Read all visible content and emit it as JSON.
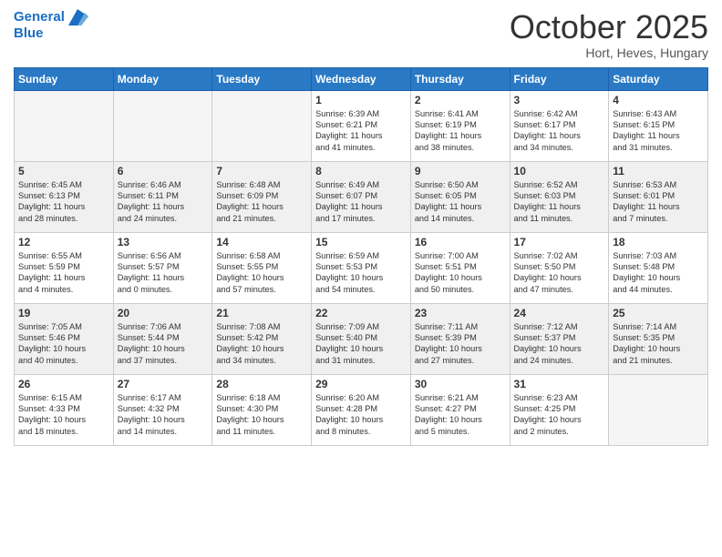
{
  "header": {
    "logo_line1": "General",
    "logo_line2": "Blue",
    "title": "October 2025",
    "subtitle": "Hort, Heves, Hungary"
  },
  "days_of_week": [
    "Sunday",
    "Monday",
    "Tuesday",
    "Wednesday",
    "Thursday",
    "Friday",
    "Saturday"
  ],
  "weeks": [
    [
      {
        "day": "",
        "info": ""
      },
      {
        "day": "",
        "info": ""
      },
      {
        "day": "",
        "info": ""
      },
      {
        "day": "1",
        "info": "Sunrise: 6:39 AM\nSunset: 6:21 PM\nDaylight: 11 hours\nand 41 minutes."
      },
      {
        "day": "2",
        "info": "Sunrise: 6:41 AM\nSunset: 6:19 PM\nDaylight: 11 hours\nand 38 minutes."
      },
      {
        "day": "3",
        "info": "Sunrise: 6:42 AM\nSunset: 6:17 PM\nDaylight: 11 hours\nand 34 minutes."
      },
      {
        "day": "4",
        "info": "Sunrise: 6:43 AM\nSunset: 6:15 PM\nDaylight: 11 hours\nand 31 minutes."
      }
    ],
    [
      {
        "day": "5",
        "info": "Sunrise: 6:45 AM\nSunset: 6:13 PM\nDaylight: 11 hours\nand 28 minutes."
      },
      {
        "day": "6",
        "info": "Sunrise: 6:46 AM\nSunset: 6:11 PM\nDaylight: 11 hours\nand 24 minutes."
      },
      {
        "day": "7",
        "info": "Sunrise: 6:48 AM\nSunset: 6:09 PM\nDaylight: 11 hours\nand 21 minutes."
      },
      {
        "day": "8",
        "info": "Sunrise: 6:49 AM\nSunset: 6:07 PM\nDaylight: 11 hours\nand 17 minutes."
      },
      {
        "day": "9",
        "info": "Sunrise: 6:50 AM\nSunset: 6:05 PM\nDaylight: 11 hours\nand 14 minutes."
      },
      {
        "day": "10",
        "info": "Sunrise: 6:52 AM\nSunset: 6:03 PM\nDaylight: 11 hours\nand 11 minutes."
      },
      {
        "day": "11",
        "info": "Sunrise: 6:53 AM\nSunset: 6:01 PM\nDaylight: 11 hours\nand 7 minutes."
      }
    ],
    [
      {
        "day": "12",
        "info": "Sunrise: 6:55 AM\nSunset: 5:59 PM\nDaylight: 11 hours\nand 4 minutes."
      },
      {
        "day": "13",
        "info": "Sunrise: 6:56 AM\nSunset: 5:57 PM\nDaylight: 11 hours\nand 0 minutes."
      },
      {
        "day": "14",
        "info": "Sunrise: 6:58 AM\nSunset: 5:55 PM\nDaylight: 10 hours\nand 57 minutes."
      },
      {
        "day": "15",
        "info": "Sunrise: 6:59 AM\nSunset: 5:53 PM\nDaylight: 10 hours\nand 54 minutes."
      },
      {
        "day": "16",
        "info": "Sunrise: 7:00 AM\nSunset: 5:51 PM\nDaylight: 10 hours\nand 50 minutes."
      },
      {
        "day": "17",
        "info": "Sunrise: 7:02 AM\nSunset: 5:50 PM\nDaylight: 10 hours\nand 47 minutes."
      },
      {
        "day": "18",
        "info": "Sunrise: 7:03 AM\nSunset: 5:48 PM\nDaylight: 10 hours\nand 44 minutes."
      }
    ],
    [
      {
        "day": "19",
        "info": "Sunrise: 7:05 AM\nSunset: 5:46 PM\nDaylight: 10 hours\nand 40 minutes."
      },
      {
        "day": "20",
        "info": "Sunrise: 7:06 AM\nSunset: 5:44 PM\nDaylight: 10 hours\nand 37 minutes."
      },
      {
        "day": "21",
        "info": "Sunrise: 7:08 AM\nSunset: 5:42 PM\nDaylight: 10 hours\nand 34 minutes."
      },
      {
        "day": "22",
        "info": "Sunrise: 7:09 AM\nSunset: 5:40 PM\nDaylight: 10 hours\nand 31 minutes."
      },
      {
        "day": "23",
        "info": "Sunrise: 7:11 AM\nSunset: 5:39 PM\nDaylight: 10 hours\nand 27 minutes."
      },
      {
        "day": "24",
        "info": "Sunrise: 7:12 AM\nSunset: 5:37 PM\nDaylight: 10 hours\nand 24 minutes."
      },
      {
        "day": "25",
        "info": "Sunrise: 7:14 AM\nSunset: 5:35 PM\nDaylight: 10 hours\nand 21 minutes."
      }
    ],
    [
      {
        "day": "26",
        "info": "Sunrise: 6:15 AM\nSunset: 4:33 PM\nDaylight: 10 hours\nand 18 minutes."
      },
      {
        "day": "27",
        "info": "Sunrise: 6:17 AM\nSunset: 4:32 PM\nDaylight: 10 hours\nand 14 minutes."
      },
      {
        "day": "28",
        "info": "Sunrise: 6:18 AM\nSunset: 4:30 PM\nDaylight: 10 hours\nand 11 minutes."
      },
      {
        "day": "29",
        "info": "Sunrise: 6:20 AM\nSunset: 4:28 PM\nDaylight: 10 hours\nand 8 minutes."
      },
      {
        "day": "30",
        "info": "Sunrise: 6:21 AM\nSunset: 4:27 PM\nDaylight: 10 hours\nand 5 minutes."
      },
      {
        "day": "31",
        "info": "Sunrise: 6:23 AM\nSunset: 4:25 PM\nDaylight: 10 hours\nand 2 minutes."
      },
      {
        "day": "",
        "info": ""
      }
    ]
  ]
}
